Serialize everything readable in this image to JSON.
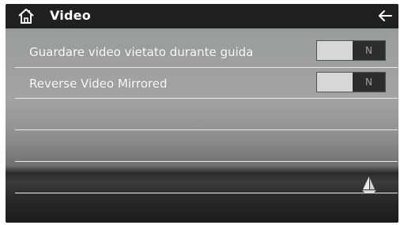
{
  "header": {
    "title": "Video",
    "home_icon": "home-icon",
    "back_icon": "back-arrow-icon"
  },
  "settings": [
    {
      "label": "Guardare video vietato durante guida",
      "toggle_value": "N"
    },
    {
      "label": "Reverse Video Mirrored",
      "toggle_value": "N"
    }
  ],
  "colors": {
    "header_bg": "#1f2021",
    "toggle_on_bg": "#2b2d2e",
    "toggle_off_bg": "#d6d8d8",
    "text": "#ffffff"
  }
}
